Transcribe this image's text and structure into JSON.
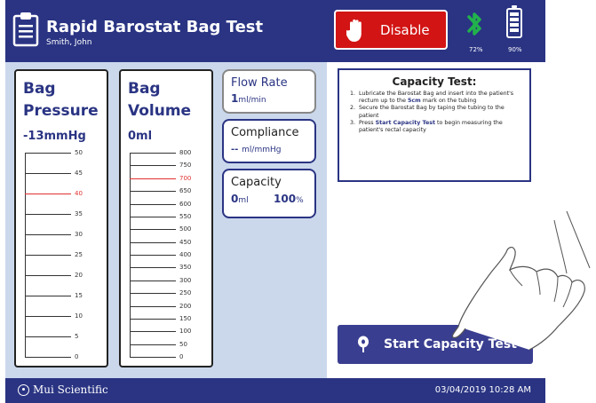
{
  "header": {
    "title": "Rapid Barostat Bag Test",
    "patient": "Smith, John",
    "disable_label": "Disable",
    "bluetooth_pct": "72%",
    "battery_pct": "90%"
  },
  "pressure_gauge": {
    "title_line1": "Bag",
    "title_line2": "Pressure",
    "value": "-13mmHg",
    "ticks": [
      "50",
      "45",
      "40",
      "35",
      "30",
      "25",
      "20",
      "15",
      "10",
      "5",
      "0"
    ],
    "highlight_tick": "40"
  },
  "volume_gauge": {
    "title_line1": "Bag",
    "title_line2": "Volume",
    "value": "0ml",
    "ticks": [
      "800",
      "750",
      "700",
      "650",
      "600",
      "550",
      "500",
      "450",
      "400",
      "350",
      "300",
      "250",
      "200",
      "150",
      "100",
      "50",
      "0"
    ],
    "highlight_tick": "700"
  },
  "flow_rate": {
    "title": "Flow Rate",
    "value": "1",
    "unit": "ml/min"
  },
  "compliance": {
    "title": "Compliance",
    "value": "--",
    "unit": "ml/mmHg"
  },
  "capacity": {
    "title": "Capacity",
    "value": "0",
    "unit": "ml",
    "percent": "100",
    "percent_unit": "%"
  },
  "instructions": {
    "title": "Capacity Test:",
    "step1_a": "Lubricate the Barostat Bag and insert into the patient's rectum up to the ",
    "step1_hl": "5cm",
    "step1_b": " mark on the tubing",
    "step2": "Secure the Barostat Bag by taping the tubing to the patient",
    "step3_a": "Press ",
    "step3_hl": "Start Capacity Test",
    "step3_b": " to begin measuring the patient's rectal capacity"
  },
  "start_button": {
    "label": "Start Capacity Test"
  },
  "footer": {
    "brand": "Mui Scientific",
    "datetime": "03/04/2019 10:28 AM"
  },
  "colors": {
    "navy": "#2a3483",
    "panel": "#cbd8ec",
    "disable_red": "#d21414",
    "bluetooth_green": "#22b24c",
    "highlight_red": "#e03030"
  }
}
